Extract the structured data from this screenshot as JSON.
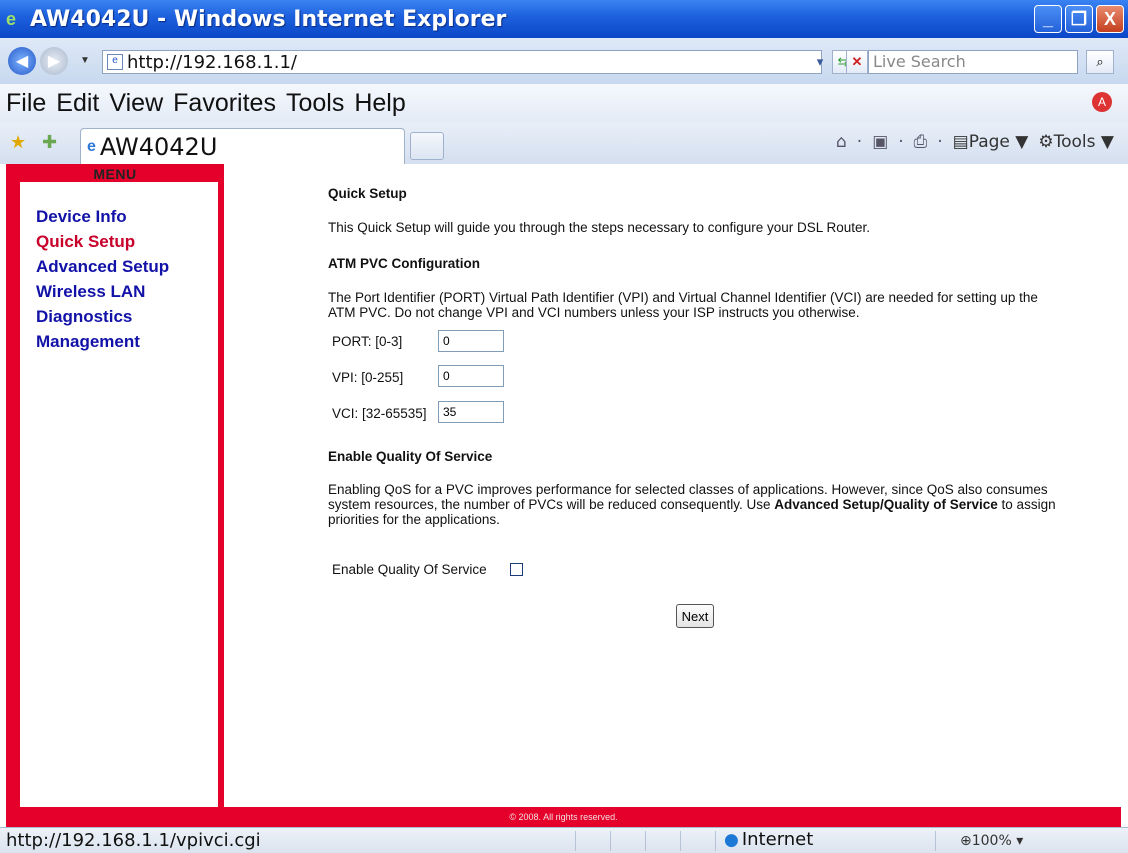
{
  "window": {
    "title": "AW4042U - Windows Internet Explorer",
    "minimize": "_",
    "maximize": "❐",
    "close": "X"
  },
  "address": {
    "url": "http://192.168.1.1/",
    "search_placeholder": "Live Search"
  },
  "menubar": {
    "items": [
      "File",
      "Edit",
      "View",
      "Favorites",
      "Tools",
      "Help"
    ]
  },
  "tabs": {
    "active_label": "AW4042U"
  },
  "commandbar": {
    "page_label": "Page",
    "tools_label": "Tools"
  },
  "sidebar": {
    "title": "MENU",
    "items": [
      {
        "label": "Device Info"
      },
      {
        "label": "Quick Setup"
      },
      {
        "label": "Advanced Setup"
      },
      {
        "label": "Wireless LAN"
      },
      {
        "label": "Diagnostics"
      },
      {
        "label": "Management"
      }
    ]
  },
  "main": {
    "heading": "Quick Setup",
    "intro": "This Quick Setup will guide you through the steps necessary to configure your DSL Router.",
    "atm_heading": "ATM PVC Configuration",
    "atm_text": "The Port Identifier (PORT) Virtual Path Identifier (VPI) and Virtual Channel Identifier (VCI) are needed for setting up the ATM PVC. Do not change VPI and VCI numbers unless your ISP instructs you otherwise.",
    "port_label": "PORT: [0-3]",
    "port_value": "0",
    "vpi_label": "VPI: [0-255]",
    "vpi_value": "0",
    "vci_label": "VCI: [32-65535]",
    "vci_value": "35",
    "qos_heading": "Enable Quality Of Service",
    "qos_text_1": "Enabling QoS for a PVC improves performance for selected classes of applications. However, since QoS also consumes system resources, the number of PVCs will be reduced consequently. Use ",
    "qos_text_bold": "Advanced Setup/Quality of Service",
    "qos_text_2": " to assign priorities for the applications.",
    "qos_checkbox_label": "Enable Quality Of Service",
    "qos_checked": false,
    "next_label": "Next"
  },
  "footer": {
    "copyright": "© 2008. All rights reserved."
  },
  "status": {
    "text": "http://192.168.1.1/vpivci.cgi",
    "zone": "Internet",
    "zoom": "100%"
  }
}
